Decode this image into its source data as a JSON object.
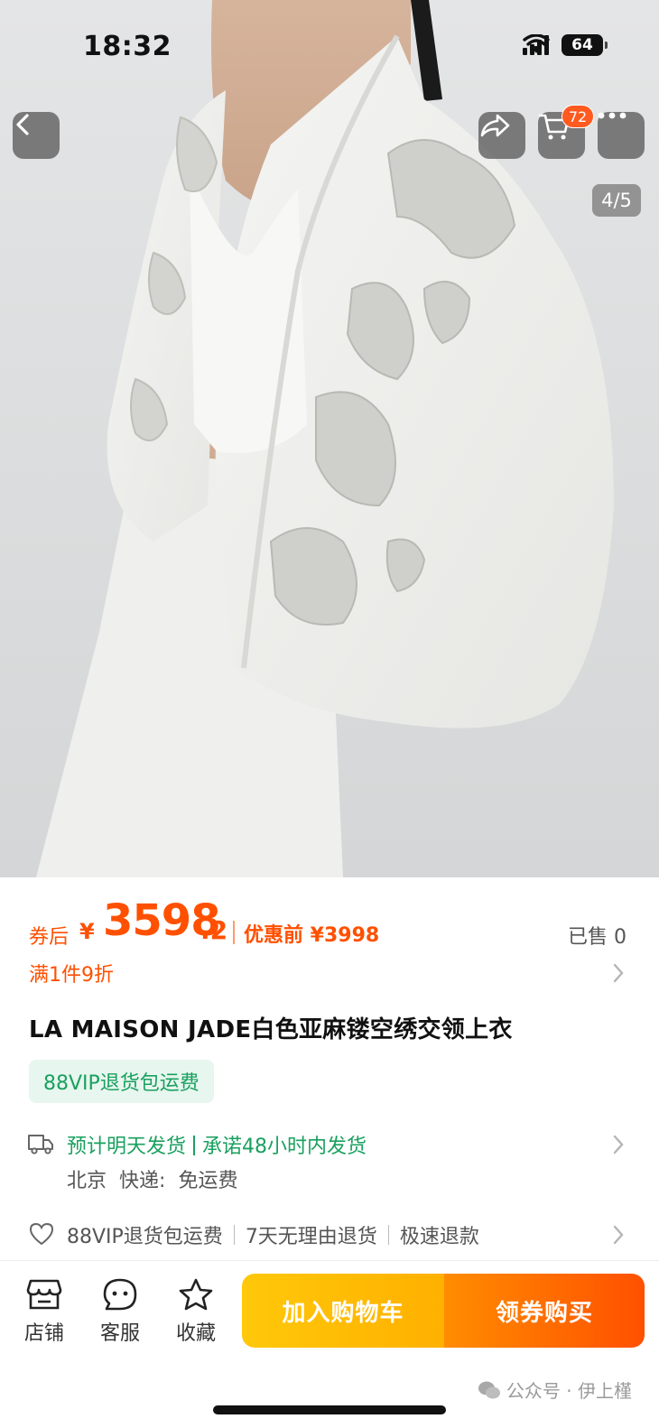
{
  "status_bar": {
    "time": "18:32",
    "battery": "64"
  },
  "nav": {
    "cart_count": "72",
    "image_counter": "4/5"
  },
  "price": {
    "label": "券后",
    "currency": "¥",
    "integer": "3598",
    "decimal": ".2",
    "before_label": "优惠前 ¥3998",
    "sold": "已售 0"
  },
  "promo": {
    "discount": "满1件9折"
  },
  "product": {
    "title": "LA MAISON JADE白色亚麻镂空绣交领上衣"
  },
  "vip_tag": "88VIP退货包运费",
  "shipping": {
    "eta": "预计明天发货",
    "promise": "承诺48小时内发货",
    "origin": "北京",
    "method": "快递:",
    "fee": "免运费"
  },
  "guarantees": [
    "88VIP退货包运费",
    "7天无理由退货",
    "极速退款"
  ],
  "bottom_bar": {
    "store_label": "店铺",
    "service_label": "客服",
    "favorite_label": "收藏",
    "add_to_cart": "加入购物车",
    "buy": "领券购买"
  },
  "watermark": "公众号 · 伊上槿",
  "colors": {
    "accent": "#ff5000",
    "green": "#1aa05f",
    "cart_btn": "#ffc80a",
    "buy_btn": "#ff5000"
  }
}
